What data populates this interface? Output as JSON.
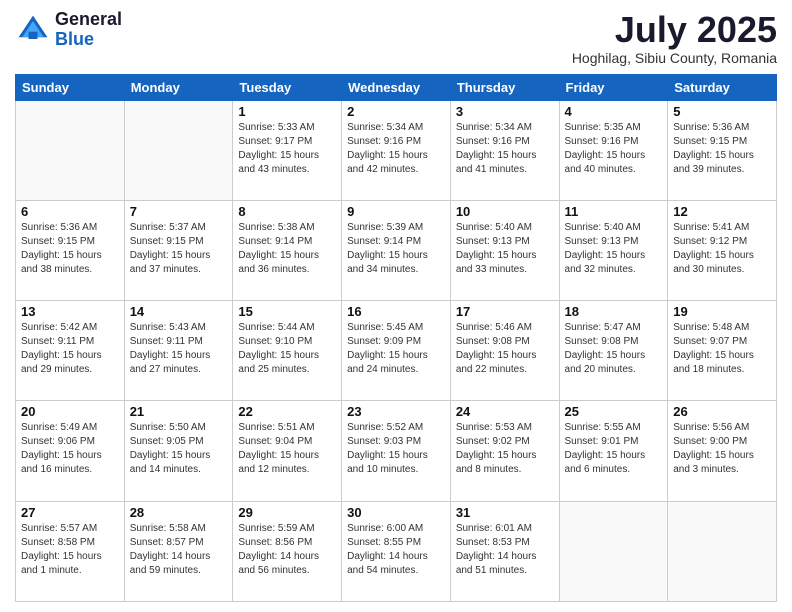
{
  "header": {
    "logo_general": "General",
    "logo_blue": "Blue",
    "month_year": "July 2025",
    "location": "Hoghilag, Sibiu County, Romania"
  },
  "days_of_week": [
    "Sunday",
    "Monday",
    "Tuesday",
    "Wednesday",
    "Thursday",
    "Friday",
    "Saturday"
  ],
  "weeks": [
    [
      {
        "day": "",
        "info": ""
      },
      {
        "day": "",
        "info": ""
      },
      {
        "day": "1",
        "info": "Sunrise: 5:33 AM\nSunset: 9:17 PM\nDaylight: 15 hours\nand 43 minutes."
      },
      {
        "day": "2",
        "info": "Sunrise: 5:34 AM\nSunset: 9:16 PM\nDaylight: 15 hours\nand 42 minutes."
      },
      {
        "day": "3",
        "info": "Sunrise: 5:34 AM\nSunset: 9:16 PM\nDaylight: 15 hours\nand 41 minutes."
      },
      {
        "day": "4",
        "info": "Sunrise: 5:35 AM\nSunset: 9:16 PM\nDaylight: 15 hours\nand 40 minutes."
      },
      {
        "day": "5",
        "info": "Sunrise: 5:36 AM\nSunset: 9:15 PM\nDaylight: 15 hours\nand 39 minutes."
      }
    ],
    [
      {
        "day": "6",
        "info": "Sunrise: 5:36 AM\nSunset: 9:15 PM\nDaylight: 15 hours\nand 38 minutes."
      },
      {
        "day": "7",
        "info": "Sunrise: 5:37 AM\nSunset: 9:15 PM\nDaylight: 15 hours\nand 37 minutes."
      },
      {
        "day": "8",
        "info": "Sunrise: 5:38 AM\nSunset: 9:14 PM\nDaylight: 15 hours\nand 36 minutes."
      },
      {
        "day": "9",
        "info": "Sunrise: 5:39 AM\nSunset: 9:14 PM\nDaylight: 15 hours\nand 34 minutes."
      },
      {
        "day": "10",
        "info": "Sunrise: 5:40 AM\nSunset: 9:13 PM\nDaylight: 15 hours\nand 33 minutes."
      },
      {
        "day": "11",
        "info": "Sunrise: 5:40 AM\nSunset: 9:13 PM\nDaylight: 15 hours\nand 32 minutes."
      },
      {
        "day": "12",
        "info": "Sunrise: 5:41 AM\nSunset: 9:12 PM\nDaylight: 15 hours\nand 30 minutes."
      }
    ],
    [
      {
        "day": "13",
        "info": "Sunrise: 5:42 AM\nSunset: 9:11 PM\nDaylight: 15 hours\nand 29 minutes."
      },
      {
        "day": "14",
        "info": "Sunrise: 5:43 AM\nSunset: 9:11 PM\nDaylight: 15 hours\nand 27 minutes."
      },
      {
        "day": "15",
        "info": "Sunrise: 5:44 AM\nSunset: 9:10 PM\nDaylight: 15 hours\nand 25 minutes."
      },
      {
        "day": "16",
        "info": "Sunrise: 5:45 AM\nSunset: 9:09 PM\nDaylight: 15 hours\nand 24 minutes."
      },
      {
        "day": "17",
        "info": "Sunrise: 5:46 AM\nSunset: 9:08 PM\nDaylight: 15 hours\nand 22 minutes."
      },
      {
        "day": "18",
        "info": "Sunrise: 5:47 AM\nSunset: 9:08 PM\nDaylight: 15 hours\nand 20 minutes."
      },
      {
        "day": "19",
        "info": "Sunrise: 5:48 AM\nSunset: 9:07 PM\nDaylight: 15 hours\nand 18 minutes."
      }
    ],
    [
      {
        "day": "20",
        "info": "Sunrise: 5:49 AM\nSunset: 9:06 PM\nDaylight: 15 hours\nand 16 minutes."
      },
      {
        "day": "21",
        "info": "Sunrise: 5:50 AM\nSunset: 9:05 PM\nDaylight: 15 hours\nand 14 minutes."
      },
      {
        "day": "22",
        "info": "Sunrise: 5:51 AM\nSunset: 9:04 PM\nDaylight: 15 hours\nand 12 minutes."
      },
      {
        "day": "23",
        "info": "Sunrise: 5:52 AM\nSunset: 9:03 PM\nDaylight: 15 hours\nand 10 minutes."
      },
      {
        "day": "24",
        "info": "Sunrise: 5:53 AM\nSunset: 9:02 PM\nDaylight: 15 hours\nand 8 minutes."
      },
      {
        "day": "25",
        "info": "Sunrise: 5:55 AM\nSunset: 9:01 PM\nDaylight: 15 hours\nand 6 minutes."
      },
      {
        "day": "26",
        "info": "Sunrise: 5:56 AM\nSunset: 9:00 PM\nDaylight: 15 hours\nand 3 minutes."
      }
    ],
    [
      {
        "day": "27",
        "info": "Sunrise: 5:57 AM\nSunset: 8:58 PM\nDaylight: 15 hours\nand 1 minute."
      },
      {
        "day": "28",
        "info": "Sunrise: 5:58 AM\nSunset: 8:57 PM\nDaylight: 14 hours\nand 59 minutes."
      },
      {
        "day": "29",
        "info": "Sunrise: 5:59 AM\nSunset: 8:56 PM\nDaylight: 14 hours\nand 56 minutes."
      },
      {
        "day": "30",
        "info": "Sunrise: 6:00 AM\nSunset: 8:55 PM\nDaylight: 14 hours\nand 54 minutes."
      },
      {
        "day": "31",
        "info": "Sunrise: 6:01 AM\nSunset: 8:53 PM\nDaylight: 14 hours\nand 51 minutes."
      },
      {
        "day": "",
        "info": ""
      },
      {
        "day": "",
        "info": ""
      }
    ]
  ]
}
